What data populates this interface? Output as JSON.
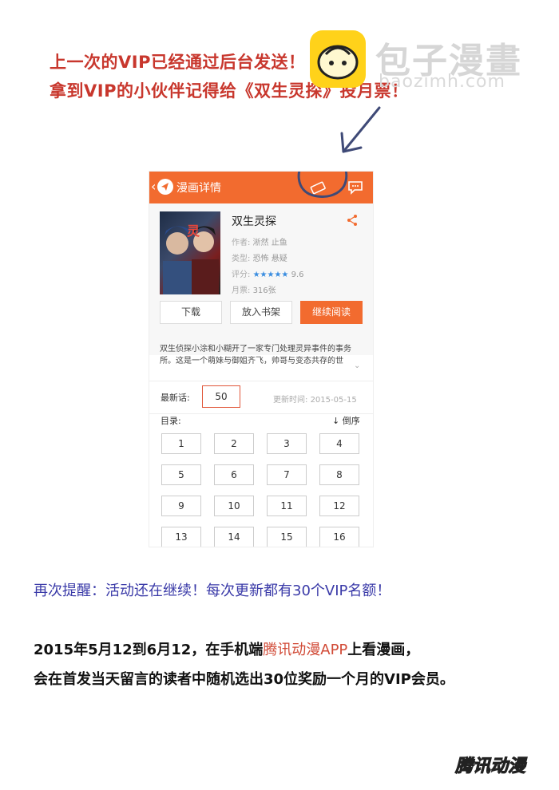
{
  "header_notes": {
    "line1": "上一次的VIP已经通过后台发送！",
    "line2": "拿到VIP的小伙伴记得给《双生灵探》投月票！"
  },
  "watermark": {
    "text": "包子漫畫",
    "url": "baozimh.com"
  },
  "phone": {
    "topbar": {
      "back": "‹",
      "title": "漫画详情"
    },
    "comic": {
      "title": "双生灵探",
      "author_label": "作者:",
      "author": "淅然 止鱼",
      "type_label": "类型:",
      "type": "恐怖 悬疑",
      "rating_label": "评分:",
      "stars": "★★★★★",
      "rating": "9.6",
      "monthly_label": "月票:",
      "monthly": "316张"
    },
    "buttons": {
      "download": "下载",
      "bookshelf": "放入书架",
      "continue": "继续阅读"
    },
    "description": "双生侦探小涂和小糊开了一家专门处理灵异事件的事务所。这是一个萌妹与御姐齐飞，帅哥与变态共存的世",
    "latest": {
      "label": "最新话:",
      "value": "50",
      "update_label": "更新时间:",
      "update": "2015-05-15"
    },
    "toc": {
      "label": "目录:",
      "sort": "↓ 倒序",
      "chapters": [
        "1",
        "2",
        "3",
        "4",
        "5",
        "6",
        "7",
        "8",
        "9",
        "10",
        "11",
        "12",
        "13",
        "14",
        "15",
        "16"
      ]
    }
  },
  "remind": "再次提醒：活动还在继续！每次更新都有30个VIP名额！",
  "bottom": {
    "line1_pre": "2015年5月12到6月12，在手机端",
    "line1_highlight": "腾讯动漫APP",
    "line1_post": "上看漫画，",
    "line2": "会在首发当天留言的读者中随机选出30位奖励一个月的VIP会员。"
  },
  "footer_logo": "腾讯动漫",
  "colors": {
    "orange": "#f26b2f",
    "red_note": "#c8372d",
    "blue_note": "#3a3aa8",
    "annotation": "#3f4a77"
  }
}
